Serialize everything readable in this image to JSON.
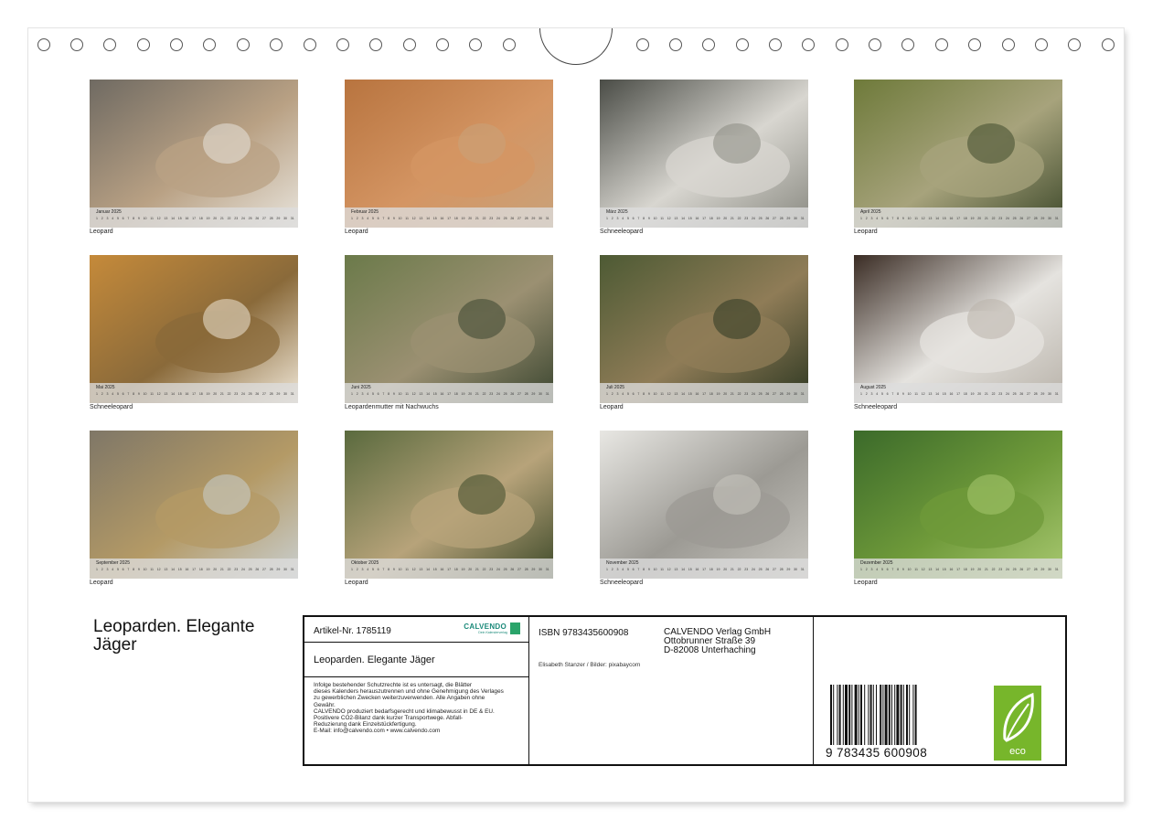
{
  "title": "Leoparden. Elegante Jäger",
  "tiles": [
    {
      "month": "Januar",
      "caption": "Leopard",
      "tone": "a"
    },
    {
      "month": "Februar",
      "caption": "Leopard",
      "tone": "b"
    },
    {
      "month": "März",
      "caption": "Schneeleopard",
      "tone": "c"
    },
    {
      "month": "April",
      "caption": "Leopard",
      "tone": "d"
    },
    {
      "month": "Mai",
      "caption": "Schneeleopard",
      "tone": "e"
    },
    {
      "month": "Juni",
      "caption": "Leopardenmutter mit Nachwuchs",
      "tone": "f"
    },
    {
      "month": "Juli",
      "caption": "Leopard",
      "tone": "g"
    },
    {
      "month": "August",
      "caption": "Schneeleopard",
      "tone": "h"
    },
    {
      "month": "September",
      "caption": "Leopard",
      "tone": "i"
    },
    {
      "month": "Oktober",
      "caption": "Leopard",
      "tone": "j"
    },
    {
      "month": "November",
      "caption": "Schneeleopard",
      "tone": "k"
    },
    {
      "month": "Dezember",
      "caption": "Leopard",
      "tone": "l"
    }
  ],
  "year": "2025",
  "info": {
    "article": "Artikel-Nr. 1785119",
    "brand": "CALVENDO",
    "brand_sub": "Dein Kalenderverlag",
    "product": "Leoparden. Elegante Jäger",
    "legal": [
      "Infolge bestehender Schutzrechte ist es untersagt, die Blätter",
      "dieses Kalenders herauszutrennen und ohne Genehmigung des Verlages",
      "zu gewerblichen Zwecken weiterzuverwenden. Alle Angaben ohne",
      "Gewähr.",
      "CALVENDO produziert bedarfsgerecht und klimabewusst in DE & EU.",
      "Positivere CO2-Bilanz dank kurzer Transportwege. Abfall-",
      "Reduzierung dank Einzelstückfertigung.",
      "E-Mail: info@calvendo.com • www.calvendo.com"
    ],
    "isbn": "ISBN 9783435600908",
    "credit": "Elisabeth Stanzer / Bilder: pixabaycom",
    "publisher": [
      "CALVENDO Verlag GmbH",
      "Ottobrunner Straße 39",
      "D-82008 Unterhaching"
    ],
    "barcode_number": "9 783435 600908",
    "eco_label": "eco"
  },
  "colors": {
    "calvendo": "#1b8a7a",
    "eco": "#77b62b"
  }
}
